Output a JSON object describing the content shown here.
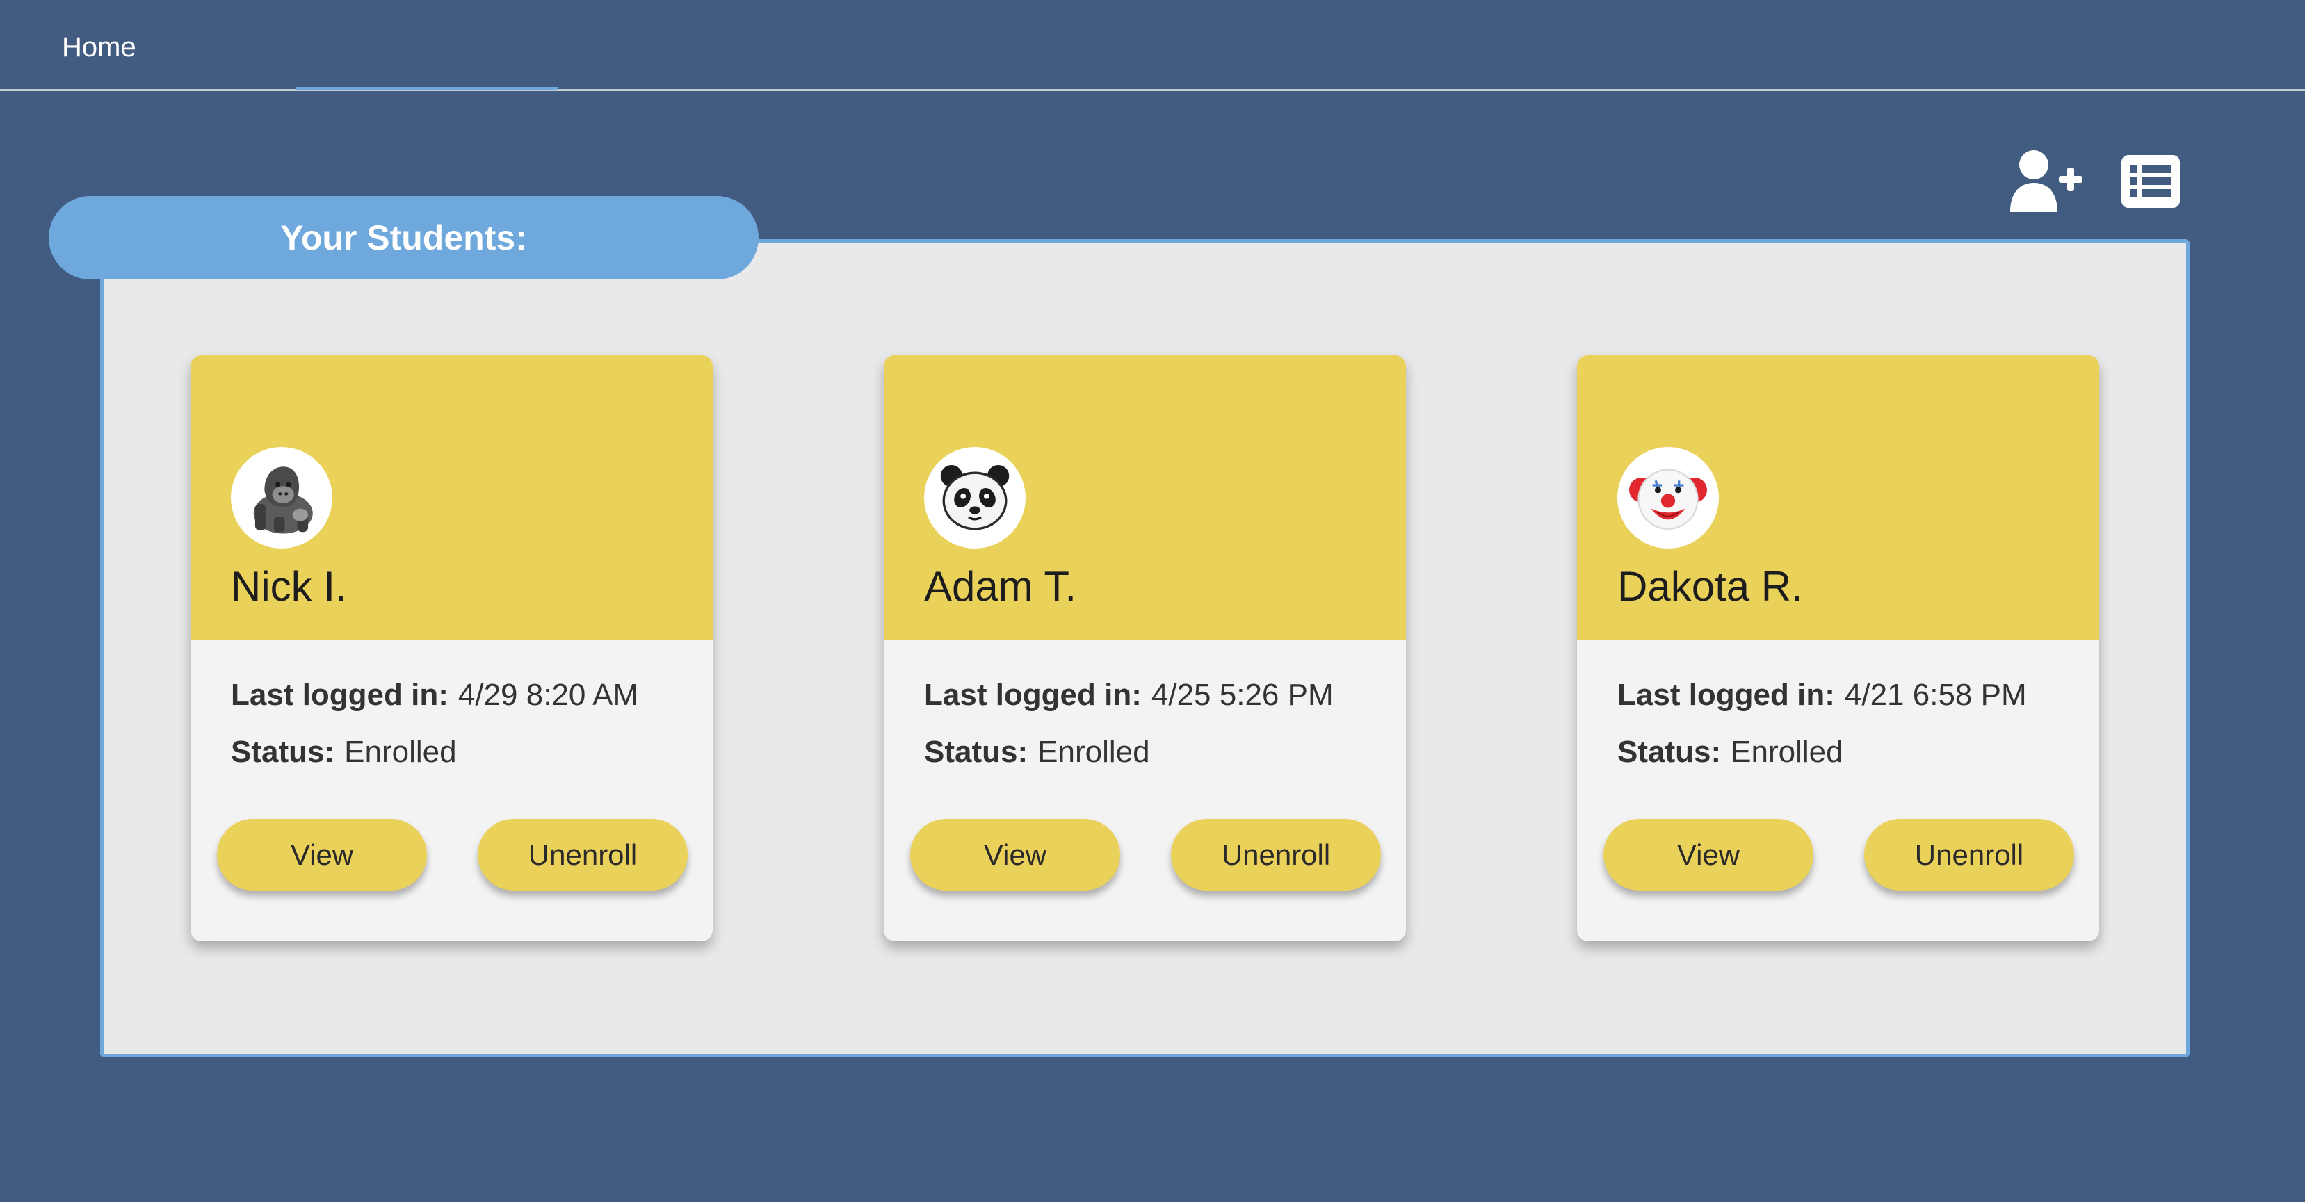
{
  "nav": {
    "home_label": "Home"
  },
  "toolbar": {
    "add_student_icon": "user-plus-icon",
    "list_view_icon": "list-icon"
  },
  "panel": {
    "title": "Your Students:"
  },
  "students": [
    {
      "name": "Nick I.",
      "avatar_icon": "gorilla-icon",
      "last_login_label": "Last logged in:",
      "last_login_value": "4/29 8:20 AM",
      "status_label": "Status:",
      "status_value": "Enrolled",
      "view_label": "View",
      "unenroll_label": "Unenroll"
    },
    {
      "name": "Adam T.",
      "avatar_icon": "panda-icon",
      "last_login_label": "Last logged in:",
      "last_login_value": "4/25 5:26 PM",
      "status_label": "Status:",
      "status_value": "Enrolled",
      "view_label": "View",
      "unenroll_label": "Unenroll"
    },
    {
      "name": "Dakota R.",
      "avatar_icon": "clown-icon",
      "last_login_label": "Last logged in:",
      "last_login_value": "4/21 6:58 PM",
      "status_label": "Status:",
      "status_value": "Enrolled",
      "view_label": "View",
      "unenroll_label": "Unenroll"
    }
  ],
  "colors": {
    "background": "#425b80",
    "accent_blue": "#6fa8dc",
    "card_yellow": "#ead159",
    "panel_gray": "#e9e9e9"
  }
}
